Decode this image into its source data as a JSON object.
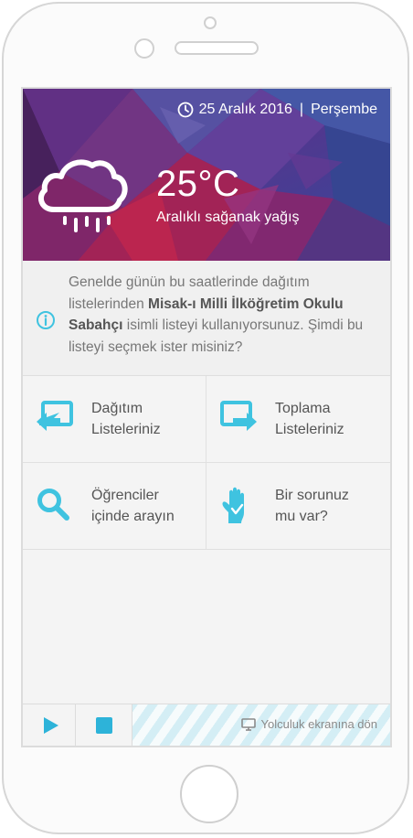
{
  "header": {
    "date": "25 Aralık 2016",
    "separator": "|",
    "day": "Perşembe"
  },
  "weather": {
    "temperature": "25°C",
    "condition": "Aralıklı sağanak yağış",
    "icon": "cloud-rain-icon"
  },
  "info": {
    "text_before": "Genelde günün bu saatlerinde dağıtım listelerinden ",
    "highlight": "Misak-ı Milli İlköğretim Okulu Sabahçı",
    "text_after": " isimli listeyi kullanıyorsunuz. Şimdi bu listeyi seçmek ister misiniz?",
    "icon": "info-icon"
  },
  "menu": {
    "items": [
      {
        "line1": "Dağıtım",
        "line2": "Listeleriniz",
        "icon": "distribution-list-icon"
      },
      {
        "line1": "Toplama",
        "line2": "Listeleriniz",
        "icon": "collection-list-icon"
      },
      {
        "line1": "Öğrenciler",
        "line2": "içinde arayın",
        "icon": "search-icon"
      },
      {
        "line1": "Bir sorunuz",
        "line2": "mu var?",
        "icon": "hand-icon"
      }
    ]
  },
  "bottombar": {
    "return_label": "Yolculuk ekranına dön"
  },
  "colors": {
    "accent": "#2db3d9",
    "icon_cyan": "#3fc3e0",
    "text": "#555555"
  }
}
